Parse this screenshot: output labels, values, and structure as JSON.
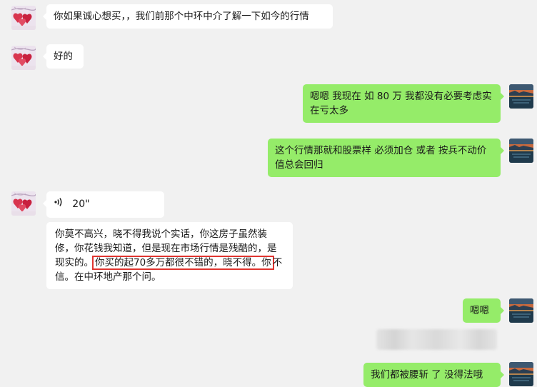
{
  "messages": [
    {
      "side": "left",
      "text": "你如果诚心想买，，我们前那个中环中介了解一下如今的行情"
    },
    {
      "side": "left",
      "text": "好的"
    },
    {
      "side": "right",
      "text": "嗯嗯 我现在 如 80 万 我都没有必要考虑实在亏太多"
    },
    {
      "side": "right",
      "text": "这个行情那就和股票样 必须加仓 或者 按兵不动价值总会回归"
    },
    {
      "side": "left",
      "type": "voice",
      "duration": "20\""
    },
    {
      "side": "left",
      "text_before": "你莫不高兴，晓不得我说个实话，你这房子虽然装修，你花钱我知道，但是现在市场行情是残酷的，是现实的。",
      "text_highlight": "你买的起70多万都很不错的，晓不得。你",
      "text_after": "不信。在中环地产那个问。"
    },
    {
      "side": "right",
      "text": "嗯嗯"
    },
    {
      "side": "right",
      "type": "redacted",
      "text": ""
    },
    {
      "side": "right",
      "text": "我们都被腰斩 了 没得法哦"
    }
  ],
  "colors": {
    "sent_bubble": "#95ec69",
    "received_bubble": "#ffffff",
    "background": "#f1f1f1",
    "highlight_box": "#e0342f"
  },
  "icons": {
    "left_avatar": "hearts-avatar-icon",
    "right_avatar": "sunset-lake-avatar-icon",
    "voice": "voice-wave-icon"
  }
}
